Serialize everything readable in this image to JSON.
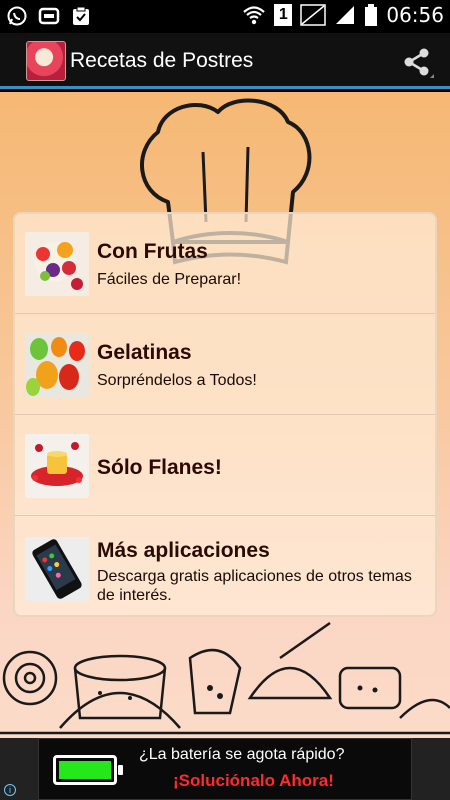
{
  "status_bar": {
    "time": "06:56",
    "sim_slot": "1",
    "icons": [
      "whatsapp-icon",
      "message-icon",
      "clipboard-icon",
      "wifi-icon",
      "no-signal-icon",
      "signal-icon",
      "battery-icon"
    ]
  },
  "app_bar": {
    "title": "Recetas de Postres",
    "share_icon": "share-icon"
  },
  "menu": {
    "items": [
      {
        "title": "Con Frutas",
        "subtitle": "Fáciles de Preparar!"
      },
      {
        "title": "Gelatinas",
        "subtitle": "Sorpréndelos a Todos!"
      },
      {
        "title": "Sólo Flanes!",
        "subtitle": ""
      },
      {
        "title": "Más aplicaciones",
        "subtitle": "Descarga gratis aplicaciones de otros temas de interés."
      }
    ]
  },
  "ad": {
    "line1": "¿La batería se agota rápido?",
    "line2": "¡Soluciónalo Ahora!",
    "info": "i",
    "battery_level": 0.9
  },
  "colors": {
    "accent": "#3a8fc4",
    "title_text": "#2b0a05",
    "ad_highlight": "#ff2a2a"
  }
}
